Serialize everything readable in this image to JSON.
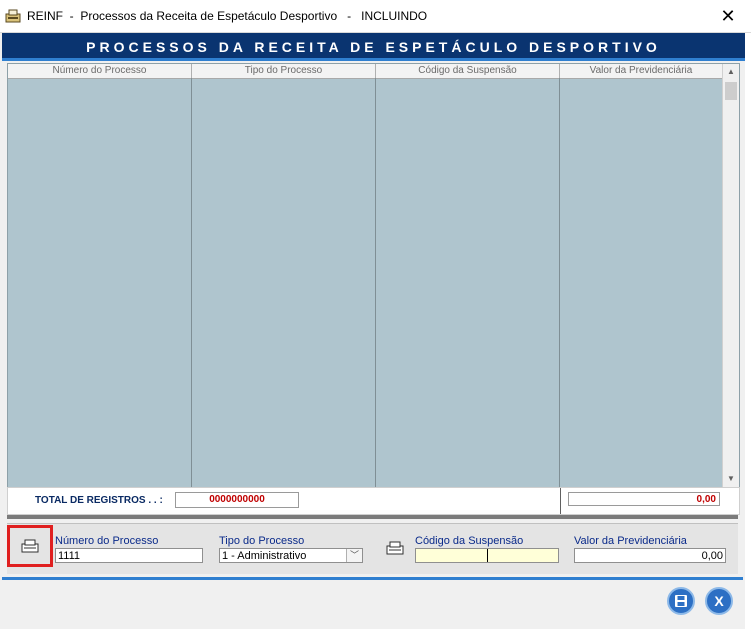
{
  "window": {
    "title": "REINF  -  Processos da Receita de Espetáculo Desportivo   -   INCLUINDO",
    "close_glyph": "✕"
  },
  "header": {
    "title": "PROCESSOS DA RECEITA DE ESPETÁCULO DESPORTIVO"
  },
  "grid": {
    "columns": [
      "Número do Processo",
      "Tipo do Processo",
      "Código da Suspensão",
      "Valor da Previdenciária"
    ],
    "rows": []
  },
  "totals": {
    "label": "TOTAL DE REGISTROS . . :",
    "count": "0000000000",
    "value": "0,00"
  },
  "form": {
    "numero_label": "Número do Processo",
    "numero_value": "1111",
    "tipo_label": "Tipo do Processo",
    "tipo_value": "1 - Administrativo",
    "codigo_label": "Código da Suspensão",
    "codigo_value": "",
    "valor_label": "Valor da Previdenciária",
    "valor_value": "0,00"
  },
  "actions": {
    "save_glyph": "💾",
    "close_glyph": "X"
  },
  "colors": {
    "header_bg": "#0a3470",
    "grid_bg": "#afc5ce",
    "accent": "#2f7fd0",
    "total_text": "#c00000",
    "highlight_border": "#e02020"
  }
}
